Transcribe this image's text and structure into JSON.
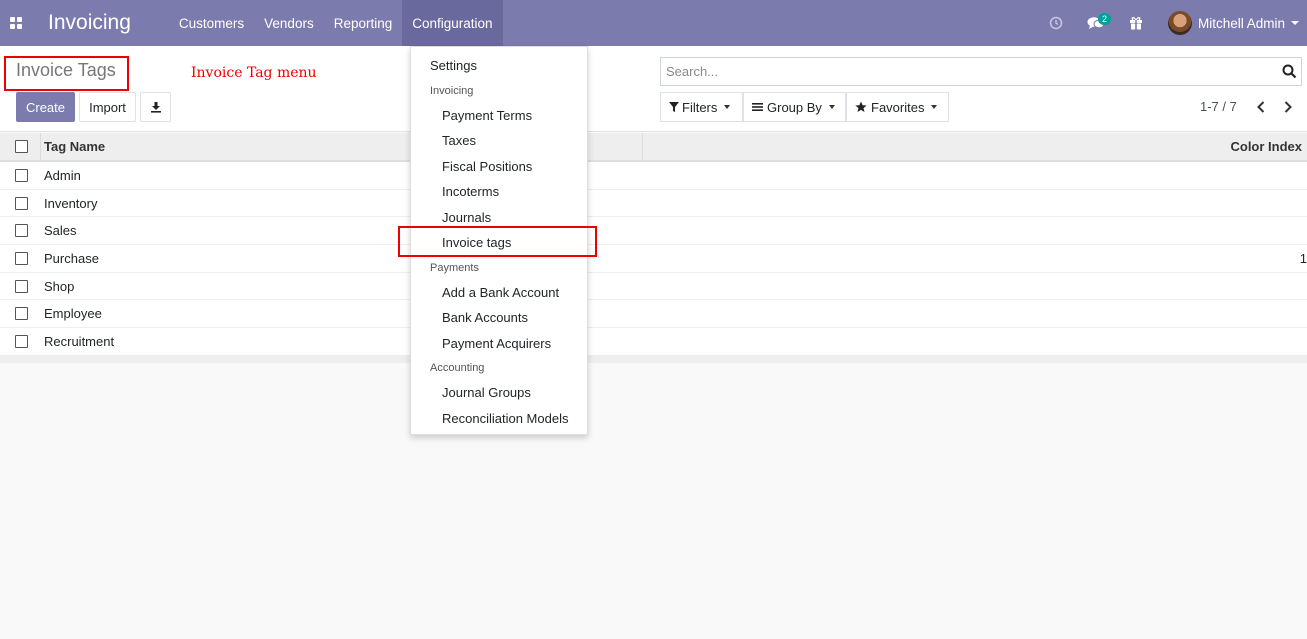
{
  "navbar": {
    "app_title": "Invoicing",
    "menu": [
      "Customers",
      "Vendors",
      "Reporting",
      "Configuration"
    ],
    "active_menu": "Configuration",
    "message_count": "2",
    "user_name": "Mitchell Admin",
    "accent_color": "#7c7bad"
  },
  "control_panel": {
    "page_title": "Invoice Tags",
    "annotation": "Invoice Tag menu",
    "create_label": "Create",
    "import_label": "Import",
    "search_placeholder": "Search...",
    "filters_label": "Filters",
    "group_by_label": "Group By",
    "favorites_label": "Favorites",
    "pager": "1-7 / 7"
  },
  "list": {
    "columns": [
      "Tag Name",
      "Color Index"
    ],
    "rows": [
      {
        "name": "Admin",
        "color": ""
      },
      {
        "name": "Inventory",
        "color": ""
      },
      {
        "name": "Sales",
        "color": ""
      },
      {
        "name": "Purchase",
        "color": "1"
      },
      {
        "name": "Shop",
        "color": ""
      },
      {
        "name": "Employee",
        "color": ""
      },
      {
        "name": "Recruitment",
        "color": ""
      }
    ]
  },
  "dropdown": {
    "settings": "Settings",
    "invoicing_header": "Invoicing",
    "invoicing_items": [
      "Payment Terms",
      "Taxes",
      "Fiscal Positions",
      "Incoterms",
      "Journals",
      "Invoice tags"
    ],
    "payments_header": "Payments",
    "payments_items": [
      "Add a Bank Account",
      "Bank Accounts",
      "Payment Acquirers"
    ],
    "accounting_header": "Accounting",
    "accounting_items": [
      "Journal Groups",
      "Reconciliation Models"
    ]
  }
}
